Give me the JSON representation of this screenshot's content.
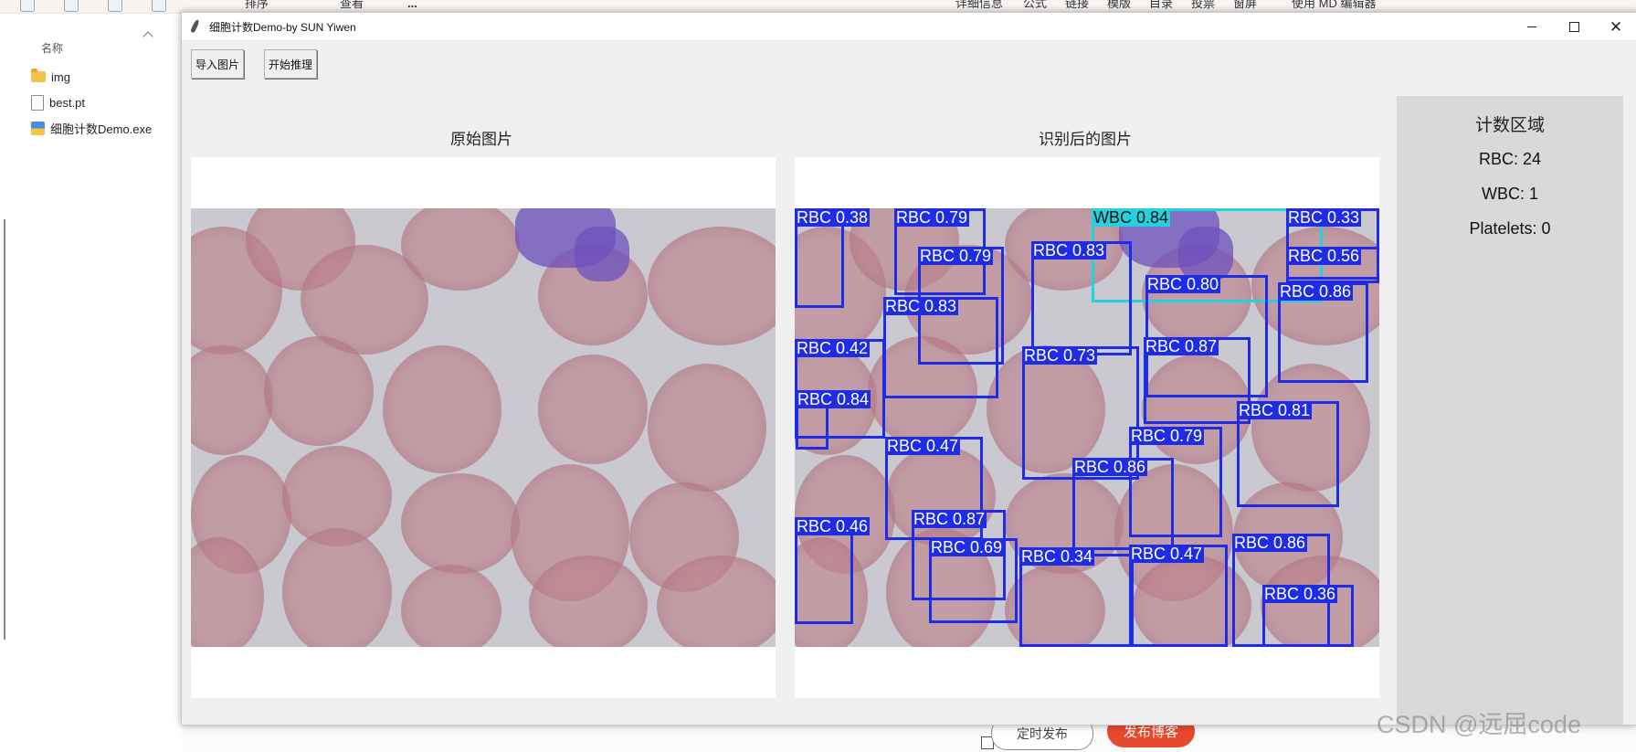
{
  "background": {
    "toolbar": {
      "sort_label": "排序",
      "view_label": "查看",
      "more_label": "...",
      "details_label": "详细信息",
      "editor_items": [
        "公式",
        "链接",
        "模版",
        "目录",
        "投票",
        "窗屏"
      ],
      "md_editor_label": "使用 MD 编辑器"
    },
    "explorer": {
      "column_header": "名称",
      "files": [
        {
          "name": "img",
          "icon": "folder-icon"
        },
        {
          "name": "best.pt",
          "icon": "document-icon"
        },
        {
          "name": "细胞计数Demo.exe",
          "icon": "executable-icon"
        }
      ]
    },
    "schedule_button": "定时发布",
    "publish_button": "发布博客",
    "watermark": "CSDN @远屈code"
  },
  "window": {
    "title": "细胞计数Demo-by SUN Yiwen",
    "controls": {
      "minimize": "minimize-icon",
      "maximize": "maximize-icon",
      "close": "close-icon"
    }
  },
  "toolbar": {
    "import_label": "导入图片",
    "infer_label": "开始推理"
  },
  "panels": {
    "original_title": "原始图片",
    "result_title": "识别后的图片"
  },
  "counts": {
    "title": "计数区域",
    "rbc": "RBC: 24",
    "wbc": "WBC: 1",
    "platelets": "Platelets: 0"
  },
  "detections": [
    {
      "label": "RBC 0.38",
      "cls": "rbc"
    },
    {
      "label": "RBC 0.79",
      "cls": "rbc"
    },
    {
      "label": "WBC 0.84",
      "cls": "wbc"
    },
    {
      "label": "RBC 0.33",
      "cls": "rbc"
    },
    {
      "label": "RBC 0.79",
      "cls": "rbc"
    },
    {
      "label": "RBC 0.83",
      "cls": "rbc"
    },
    {
      "label": "RBC 0.56",
      "cls": "rbc"
    },
    {
      "label": "RBC 0.80",
      "cls": "rbc"
    },
    {
      "label": "RBC 0.86",
      "cls": "rbc"
    },
    {
      "label": "RBC 0.83",
      "cls": "rbc"
    },
    {
      "label": "RBC 0.42",
      "cls": "rbc"
    },
    {
      "label": "RBC 0.73",
      "cls": "rbc"
    },
    {
      "label": "RBC 0.87",
      "cls": "rbc"
    },
    {
      "label": "RBC 0.84",
      "cls": "rbc"
    },
    {
      "label": "RBC 0.81",
      "cls": "rbc"
    },
    {
      "label": "RBC 0.47",
      "cls": "rbc"
    },
    {
      "label": "RBC 0.79",
      "cls": "rbc"
    },
    {
      "label": "RBC 0.86",
      "cls": "rbc"
    },
    {
      "label": "RBC 0.87",
      "cls": "rbc"
    },
    {
      "label": "RBC 0.46",
      "cls": "rbc"
    },
    {
      "label": "RBC 0.69",
      "cls": "rbc"
    },
    {
      "label": "RBC 0.34",
      "cls": "rbc"
    },
    {
      "label": "RBC 0.47",
      "cls": "rbc"
    },
    {
      "label": "RBC 0.86",
      "cls": "rbc"
    },
    {
      "label": "RBC 0.36",
      "cls": "rbc"
    }
  ]
}
